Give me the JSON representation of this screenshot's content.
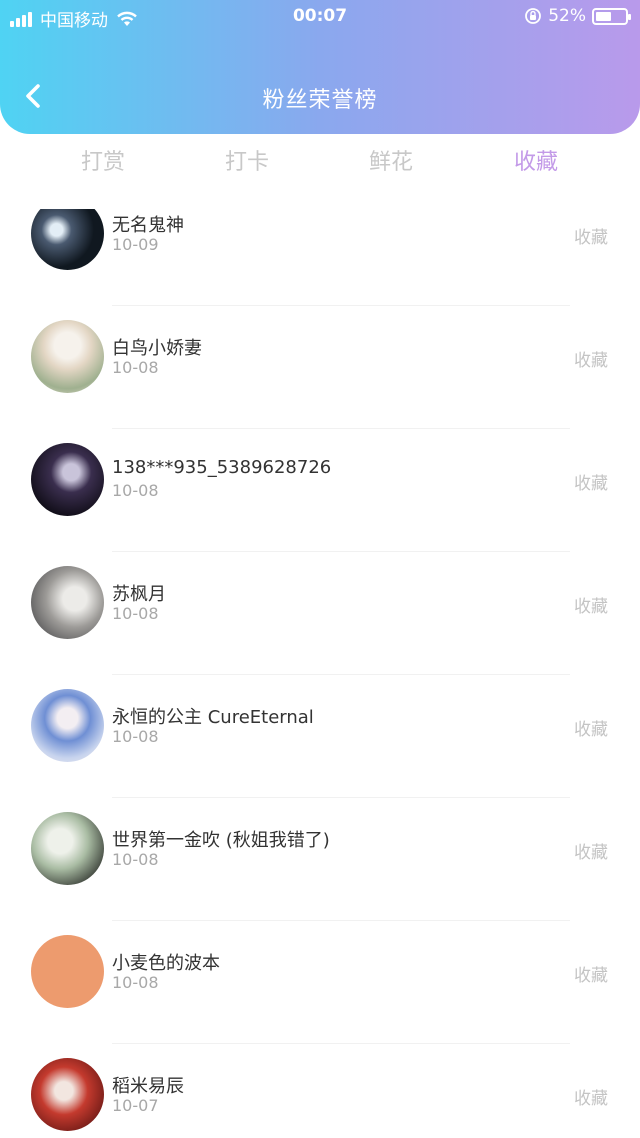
{
  "status_bar": {
    "carrier": "中国移动",
    "time": "00:07",
    "battery_percent": "52%",
    "battery_level": 0.52
  },
  "header": {
    "title": "粉丝荣誉榜",
    "back_icon": "chevron-left-icon"
  },
  "tabs": [
    {
      "label": "打赏",
      "active": false
    },
    {
      "label": "打卡",
      "active": false
    },
    {
      "label": "鲜花",
      "active": false
    },
    {
      "label": "收藏",
      "active": true
    }
  ],
  "rows": [
    {
      "name": "无名鬼神",
      "date": "10-09",
      "action": "收藏"
    },
    {
      "name": "白鸟小娇妻",
      "date": "10-08",
      "action": "收藏"
    },
    {
      "name": "138***935_5389628726",
      "date": "10-08",
      "action": "收藏"
    },
    {
      "name": "苏枫月",
      "date": "10-08",
      "action": "收藏"
    },
    {
      "name": "永恒的公主 CureEternal",
      "date": "10-08",
      "action": "收藏"
    },
    {
      "name": "世界第一金吹 (秋姐我错了)",
      "date": "10-08",
      "action": "收藏"
    },
    {
      "name": "小麦色的波本",
      "date": "10-08",
      "action": "收藏"
    },
    {
      "name": "稻米易辰",
      "date": "10-07",
      "action": "收藏"
    }
  ],
  "colors": {
    "accent": "#c39ae8",
    "header_gradient_start": "#4fd3f3",
    "header_gradient_end": "#b99aeb"
  }
}
